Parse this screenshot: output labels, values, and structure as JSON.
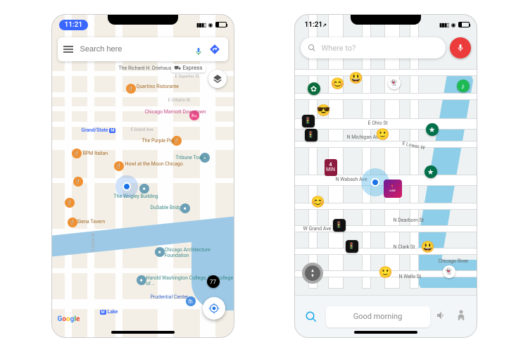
{
  "left": {
    "app": "google-maps",
    "time": "11:21",
    "search_placeholder": "Search here",
    "express_label": "Express",
    "pois": {
      "driehaus": "The Richard H.\\nDriehaus Museum",
      "marriott": "Chicago Marriott\\nDowntown",
      "quartino": "Quartino Ristorante",
      "ontario": "E Ontario St",
      "superior": "E Superior St",
      "grand_state": "Grand/State",
      "m_badge": "M",
      "e_grand": "E Grand Ave",
      "purple_pig": "The Purple Pig",
      "rpm": "RPM Italian",
      "howl": "Howl at\\nthe Moon Chicago",
      "tribune": "Tribune Tower",
      "wrigley": "The Wrigley Building",
      "dusable": "DuSable Bridge",
      "siena": "Siena Tavern",
      "caf": "Chicago Architecture\\nFoundation",
      "harold": "Harold Washington\\nCollege, City college of...",
      "prudential": "Prudential Center",
      "n_state": "N State St",
      "lake_station": "Lake",
      "m_label2": "M",
      "google": {
        "g": "G",
        "o1": "o",
        "o2": "o",
        "g2": "g",
        "l": "l",
        "e": "e"
      }
    }
  },
  "right": {
    "app": "waze",
    "time": "11:21",
    "search_placeholder": "Where to?",
    "speed_value": "4",
    "speed_unit": "MIN",
    "live_label": "LIVE",
    "greeting": "Good morning",
    "streets": {
      "e_ohio": "E Ohio St",
      "n_michigan": "N Michigan Ave",
      "e_lower": "E Lower W",
      "n_wabash": "N Wabash Ave",
      "w_grand": "W Grand Ave",
      "n_dearborn": "N Dearborn St",
      "n_clark": "N Clark St",
      "n_wells": "N Wells St",
      "chicago_river": "Chicago\\nRiver"
    }
  }
}
